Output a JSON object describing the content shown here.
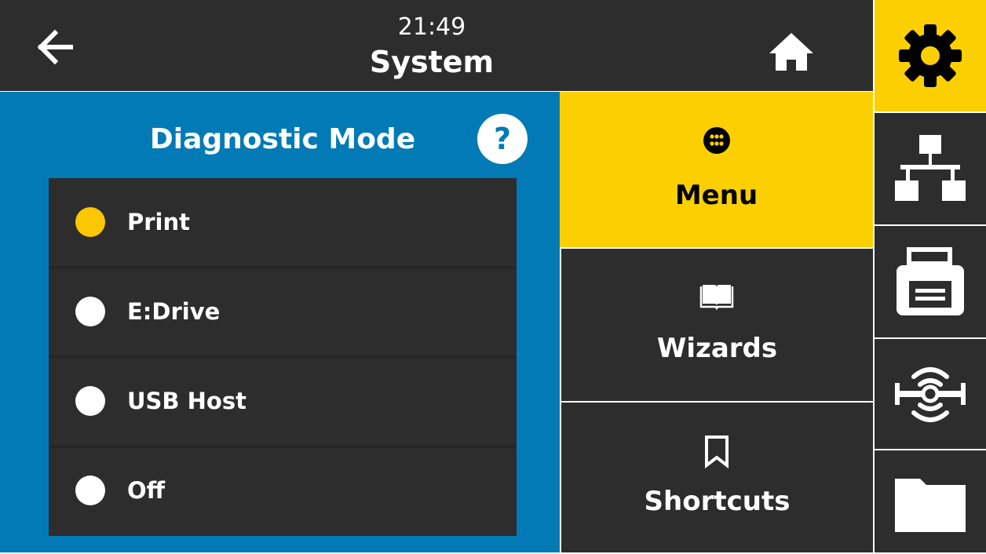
{
  "header": {
    "time": "21:49",
    "title": "System",
    "icons": {
      "back": "back-arrow-icon",
      "home": "home-icon"
    }
  },
  "setting": {
    "title": "Diagnostic Mode",
    "help_icon": "help-icon",
    "options": [
      {
        "label": "Print",
        "selected": true
      },
      {
        "label": "E:Drive",
        "selected": false
      },
      {
        "label": "USB Host",
        "selected": false
      },
      {
        "label": "Off",
        "selected": false
      }
    ]
  },
  "menu": {
    "tiles": [
      {
        "label": "Menu",
        "icon": "menu-grid-icon",
        "active": true
      },
      {
        "label": "Wizards",
        "icon": "book-icon",
        "active": false
      },
      {
        "label": "Shortcuts",
        "icon": "bookmark-icon",
        "active": false
      }
    ]
  },
  "sidebar": {
    "items": [
      {
        "icon": "settings-gear-icon",
        "active": true
      },
      {
        "icon": "network-icon",
        "active": false
      },
      {
        "icon": "printer-icon",
        "active": false
      },
      {
        "icon": "rfid-icon",
        "active": false
      },
      {
        "icon": "folder-icon",
        "active": false
      }
    ]
  },
  "colors": {
    "accent": "#fcd000",
    "panel_blue": "#027ab5",
    "dark": "#2d2d2d",
    "radio_selected": "#fcc600",
    "radio_unselected": "#ffffff"
  }
}
